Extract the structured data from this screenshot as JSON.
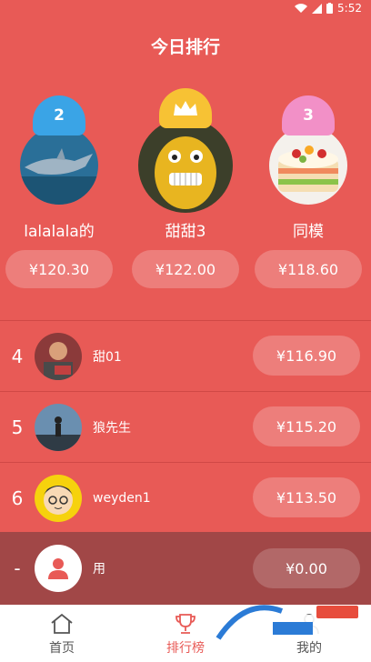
{
  "status_bar": {
    "time": "5:52"
  },
  "title": "今日排行",
  "podium": [
    {
      "position": "left",
      "badge": "2",
      "name": "lalalala的",
      "amount": "¥120.30"
    },
    {
      "position": "center",
      "badge": "",
      "name": "甜甜3",
      "amount": "¥122.00"
    },
    {
      "position": "right",
      "badge": "3",
      "name": "同模",
      "amount": "¥118.60"
    }
  ],
  "list": [
    {
      "rank": "4",
      "name": "甜01",
      "amount": "¥116.90"
    },
    {
      "rank": "5",
      "name": "狼先生",
      "amount": "¥115.20"
    },
    {
      "rank": "6",
      "name": "weyden1",
      "amount": "¥113.50"
    }
  ],
  "me": {
    "rank": "-",
    "name": "用",
    "amount": "¥0.00"
  },
  "nav": [
    {
      "label": "首页",
      "icon": "home-icon",
      "active": false
    },
    {
      "label": "排行榜",
      "icon": "trophy-icon",
      "active": true
    },
    {
      "label": "我的",
      "icon": "user-icon",
      "active": false
    }
  ],
  "colors": {
    "background": "#e85a56",
    "my_row": "#a14747",
    "accent": "#e85a56"
  }
}
